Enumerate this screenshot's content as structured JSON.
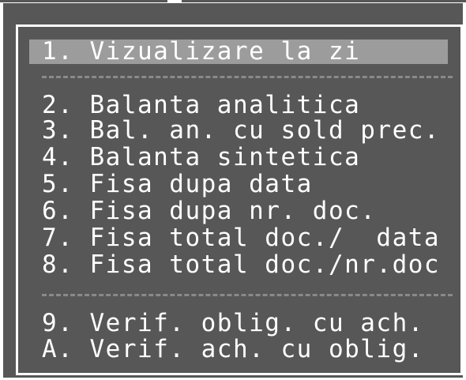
{
  "menu": {
    "selected": "1. Vizualizare la zi",
    "items": [
      "2. Balanta analitica",
      "3. Bal. an. cu sold prec.",
      "4. Balanta sintetica",
      "5. Fisa dupa data",
      "6. Fisa dupa nr. doc.",
      "7. Fisa total doc./  data",
      "8. Fisa total doc./nr.doc",
      "9. Verif. oblig. cu ach.",
      "A. Verif. ach. cu oblig."
    ]
  },
  "colors": {
    "background": "#575757",
    "highlight": "#9c9c9c",
    "text": "#ffffff",
    "separator": "#8a8a8a"
  }
}
